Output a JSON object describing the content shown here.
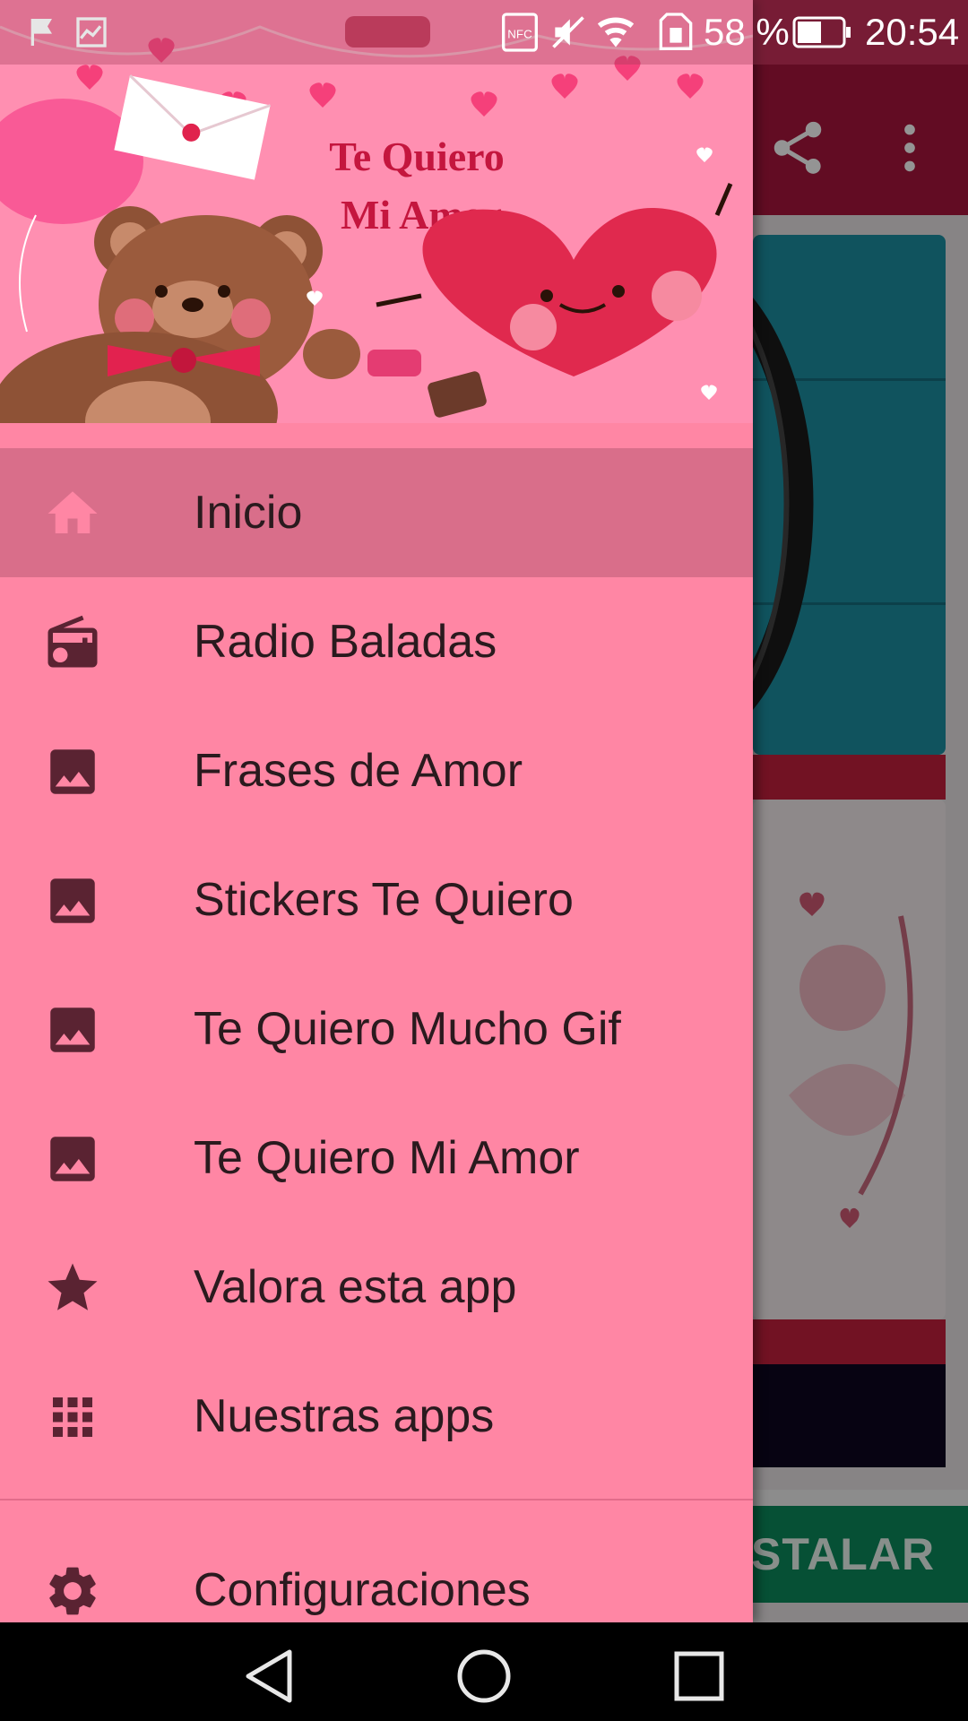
{
  "status_bar": {
    "battery_percent": "58 %",
    "time": "20:54",
    "icons": [
      "notification-icon",
      "chart-icon",
      "nfc-icon",
      "mute-icon",
      "wifi-icon",
      "sim-icon",
      "battery-icon"
    ]
  },
  "drawer": {
    "header_title": "Te Quiero\nMi Amor",
    "header_title_line1": "Te Quiero",
    "header_title_line2": "Mi Amor",
    "items": [
      {
        "label": "Inicio",
        "icon": "home-icon",
        "active": true
      },
      {
        "label": "Radio Baladas",
        "icon": "radio-icon",
        "active": false
      },
      {
        "label": "Frases de Amor",
        "icon": "image-icon",
        "active": false
      },
      {
        "label": "Stickers Te Quiero",
        "icon": "image-icon",
        "active": false
      },
      {
        "label": "Te Quiero Mucho Gif",
        "icon": "image-icon",
        "active": false
      },
      {
        "label": "Te Quiero Mi Amor",
        "icon": "image-icon",
        "active": false
      },
      {
        "label": "Valora esta app",
        "icon": "star-icon",
        "active": false
      },
      {
        "label": "Nuestras apps",
        "icon": "grid-apps-icon",
        "active": false
      }
    ],
    "settings_label": "Configuraciones"
  },
  "background": {
    "install_label": "STALAR"
  },
  "colors": {
    "drawer_bg": "#ff86a4",
    "active_item_bg": "#d96e8a",
    "toolbar_bg": "#a9163d",
    "install_bg": "#0b8a5c"
  }
}
